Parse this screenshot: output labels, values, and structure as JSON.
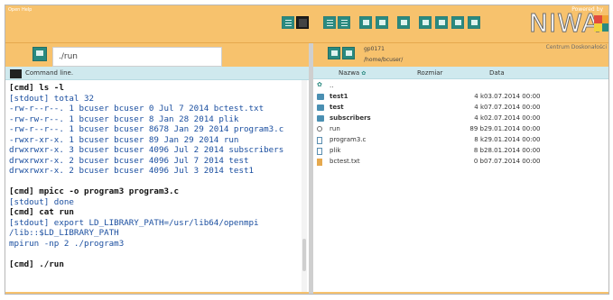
{
  "topbar": {
    "help_label": "Open Help"
  },
  "logo": {
    "powered_by": "Powered by",
    "brand": "NIWA",
    "centrum": "Centrum Doskonałości",
    "colors": [
      "#e34b3c",
      "#f0a233",
      "#f2d33b",
      "#2a8a80"
    ]
  },
  "left": {
    "path": "./run",
    "console_title": "Command line.",
    "lines": [
      {
        "kind": "cmd",
        "text": "[cmd] ls -l"
      },
      {
        "kind": "out",
        "text": "[stdout] total 32"
      },
      {
        "kind": "out",
        "text": "-rw-r--r--. 1 bcuser bcuser 0 Jul 7 2014 bctest.txt"
      },
      {
        "kind": "out",
        "text": "-rw-rw-r--. 1 bcuser bcuser 8 Jan 28 2014 plik"
      },
      {
        "kind": "out",
        "text": "-rw-r--r--. 1 bcuser bcuser 8678 Jan 29 2014 program3.c"
      },
      {
        "kind": "out",
        "text": "-rwxr-xr-x. 1 bcuser bcuser 89 Jan 29 2014 run"
      },
      {
        "kind": "out",
        "text": "drwxrwxr-x. 3 bcuser bcuser 4096 Jul 2 2014 subscribers"
      },
      {
        "kind": "out",
        "text": "drwxrwxr-x. 2 bcuser bcuser 4096 Jul 7 2014 test"
      },
      {
        "kind": "out",
        "text": "drwxrwxr-x. 2 bcuser bcuser 4096 Jul 3 2014 test1"
      },
      {
        "kind": "blank",
        "text": ""
      },
      {
        "kind": "cmd",
        "text": "[cmd] mpicc -o program3 program3.c"
      },
      {
        "kind": "out",
        "text": "[stdout] done"
      },
      {
        "kind": "cmd",
        "text": "[cmd] cat run"
      },
      {
        "kind": "out",
        "text": "[stdout] export LD_LIBRARY_PATH=/usr/lib64/openmpi"
      },
      {
        "kind": "out",
        "text": "/lib::$LD_LIBRARY_PATH"
      },
      {
        "kind": "out",
        "text": "mpirun -np 2 ./program3"
      },
      {
        "kind": "blank",
        "text": ""
      },
      {
        "kind": "cmd",
        "text": "[cmd] ./run"
      }
    ]
  },
  "right": {
    "host": "gp0171",
    "cwd": "/home/bcuser/",
    "headers": {
      "name": "Nazwa",
      "size": "Rozmiar",
      "date": "Data"
    },
    "files": [
      {
        "icon": "up-arrow-icon",
        "name": "..",
        "size": "",
        "date": "",
        "bold": false
      },
      {
        "icon": "folder-icon",
        "name": "test1",
        "size": "4 k",
        "date": "03.07.2014 00:00",
        "bold": true
      },
      {
        "icon": "folder-icon",
        "name": "test",
        "size": "4 k",
        "date": "07.07.2014 00:00",
        "bold": true
      },
      {
        "icon": "folder-icon",
        "name": "subscribers",
        "size": "4 k",
        "date": "02.07.2014 00:00",
        "bold": true
      },
      {
        "icon": "exec-icon",
        "name": "run",
        "size": "89 b",
        "date": "29.01.2014 00:00",
        "bold": false
      },
      {
        "icon": "file-icon",
        "name": "program3.c",
        "size": "8 k",
        "date": "29.01.2014 00:00",
        "bold": false
      },
      {
        "icon": "file-icon",
        "name": "plik",
        "size": "8 b",
        "date": "28.01.2014 00:00",
        "bold": false
      },
      {
        "icon": "text-file-icon",
        "name": "bctest.txt",
        "size": "0 b",
        "date": "07.07.2014 00:00",
        "bold": false
      }
    ]
  },
  "colors": {
    "accent_orange": "#f7c26d",
    "accent_teal": "#2a8a80",
    "header_blue": "#cfe9ee",
    "stdout_blue": "#1b4fa0"
  }
}
